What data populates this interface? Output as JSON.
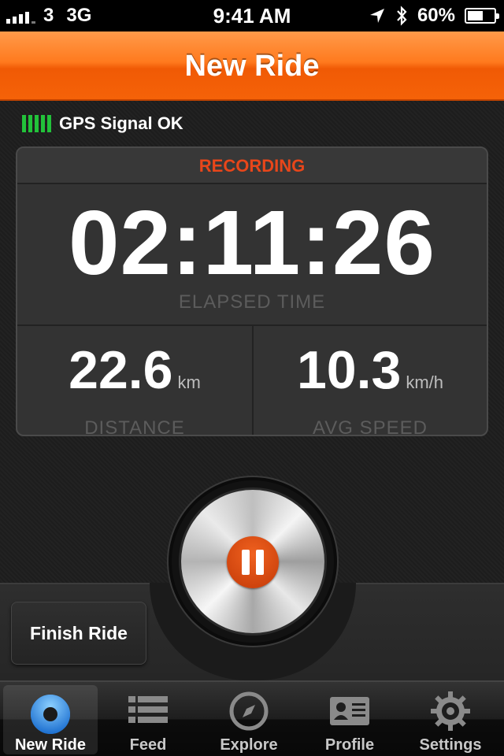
{
  "status_bar": {
    "carrier": "3",
    "network": "3G",
    "time": "9:41 AM",
    "battery": "60%",
    "battery_level": 0.6
  },
  "nav": {
    "title": "New Ride"
  },
  "gps": {
    "status": "GPS Signal OK"
  },
  "recording": {
    "state_label": "RECORDING",
    "elapsed_time": "02:11:26",
    "elapsed_label": "ELAPSED TIME",
    "distance_value": "22.6",
    "distance_unit": "km",
    "distance_label": "DISTANCE",
    "speed_value": "10.3",
    "speed_unit": "km/h",
    "speed_label": "AVG SPEED"
  },
  "controls": {
    "finish_label": "Finish Ride",
    "pause_icon": "pause-icon"
  },
  "tabs": [
    {
      "label": "New Ride",
      "icon": "record-icon",
      "active": true
    },
    {
      "label": "Feed",
      "icon": "list-icon",
      "active": false
    },
    {
      "label": "Explore",
      "icon": "compass-icon",
      "active": false
    },
    {
      "label": "Profile",
      "icon": "profile-card-icon",
      "active": false
    },
    {
      "label": "Settings",
      "icon": "gear-icon",
      "active": false
    }
  ],
  "colors": {
    "accent": "#f56208",
    "recording": "#e8461a",
    "gps_ok": "#22c23a"
  }
}
